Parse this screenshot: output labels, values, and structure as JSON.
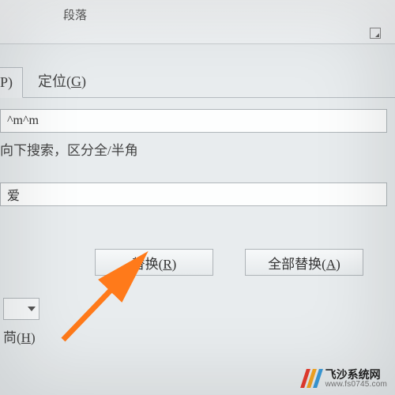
{
  "ribbon": {
    "section_label": "段落"
  },
  "tabs": {
    "partial_first": "P)",
    "locate": "定位(G)",
    "locate_key": "G"
  },
  "find": {
    "value": "^m^m",
    "options_label": "向下搜索，区分全/半角"
  },
  "replace_with": {
    "value": "爱"
  },
  "buttons": {
    "replace": "替换(R)",
    "replace_key": "R",
    "replace_all": "全部替换(A)",
    "replace_all_key": "A"
  },
  "bottom": {
    "label_partial": "苘(H)",
    "label_key": "H"
  },
  "watermark": {
    "name": "飞沙系统网",
    "url": "www.fs0745.com"
  }
}
